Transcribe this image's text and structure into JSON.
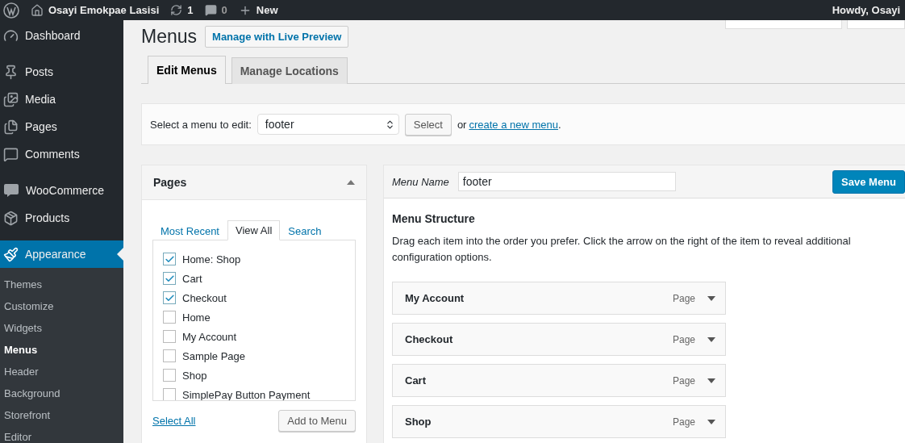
{
  "admin_bar": {
    "site_name": "Osayi Emokpae Lasisi",
    "updates": "1",
    "comments": "0",
    "new": "New",
    "greeting": "Howdy, Osayi"
  },
  "sidebar": {
    "groups": [
      [
        {
          "kind": "dashboard",
          "label": "Dashboard",
          "selected": false
        }
      ],
      [
        {
          "kind": "posts",
          "label": "Posts",
          "selected": false
        },
        {
          "kind": "media",
          "label": "Media",
          "selected": false
        },
        {
          "kind": "pages",
          "label": "Pages",
          "selected": false
        },
        {
          "kind": "comments",
          "label": "Comments",
          "selected": false
        }
      ],
      [
        {
          "kind": "woocommerce",
          "label": "WooCommerce",
          "selected": false
        },
        {
          "kind": "products",
          "label": "Products",
          "selected": false
        }
      ],
      [
        {
          "kind": "appearance",
          "label": "Appearance",
          "selected": true
        }
      ]
    ],
    "submenu": [
      {
        "label": "Themes",
        "selected": false
      },
      {
        "label": "Customize",
        "selected": false
      },
      {
        "label": "Widgets",
        "selected": false
      },
      {
        "label": "Menus",
        "selected": true
      },
      {
        "label": "Header",
        "selected": false
      },
      {
        "label": "Background",
        "selected": false
      },
      {
        "label": "Storefront",
        "selected": false
      },
      {
        "label": "Editor",
        "selected": false
      }
    ]
  },
  "page": {
    "title": "Menus",
    "live_preview": "Manage with Live Preview",
    "tabs": [
      {
        "label": "Edit Menus",
        "selected": true
      },
      {
        "label": "Manage Locations",
        "selected": false
      }
    ],
    "select_bar": {
      "label": "Select a menu to edit:",
      "value": "footer",
      "button": "Select",
      "or": "or",
      "link": "create a new menu",
      "end": "."
    }
  },
  "pages_box": {
    "title": "Pages",
    "tabs": [
      {
        "label": "Most Recent",
        "selected": false
      },
      {
        "label": "View All",
        "selected": true
      },
      {
        "label": "Search",
        "selected": false
      }
    ],
    "items": [
      {
        "label": "Home: Shop",
        "checked": true
      },
      {
        "label": "Cart",
        "checked": true
      },
      {
        "label": "Checkout",
        "checked": true
      },
      {
        "label": "Home",
        "checked": false
      },
      {
        "label": "My Account",
        "checked": false
      },
      {
        "label": "Sample Page",
        "checked": false
      },
      {
        "label": "Shop",
        "checked": false
      },
      {
        "label": "SimplePay Button Payment",
        "checked": false
      }
    ],
    "select_all": "Select All",
    "add_button": "Add to Menu"
  },
  "menu_editor": {
    "name_label": "Menu Name",
    "name_value": "footer",
    "save_button": "Save Menu",
    "heading": "Menu Structure",
    "description": "Drag each item into the order you prefer. Click the arrow on the right of the item to reveal additional configuration options.",
    "items": [
      {
        "title": "My Account",
        "type": "Page"
      },
      {
        "title": "Checkout",
        "type": "Page"
      },
      {
        "title": "Cart",
        "type": "Page"
      },
      {
        "title": "Shop",
        "type": "Page"
      }
    ]
  }
}
